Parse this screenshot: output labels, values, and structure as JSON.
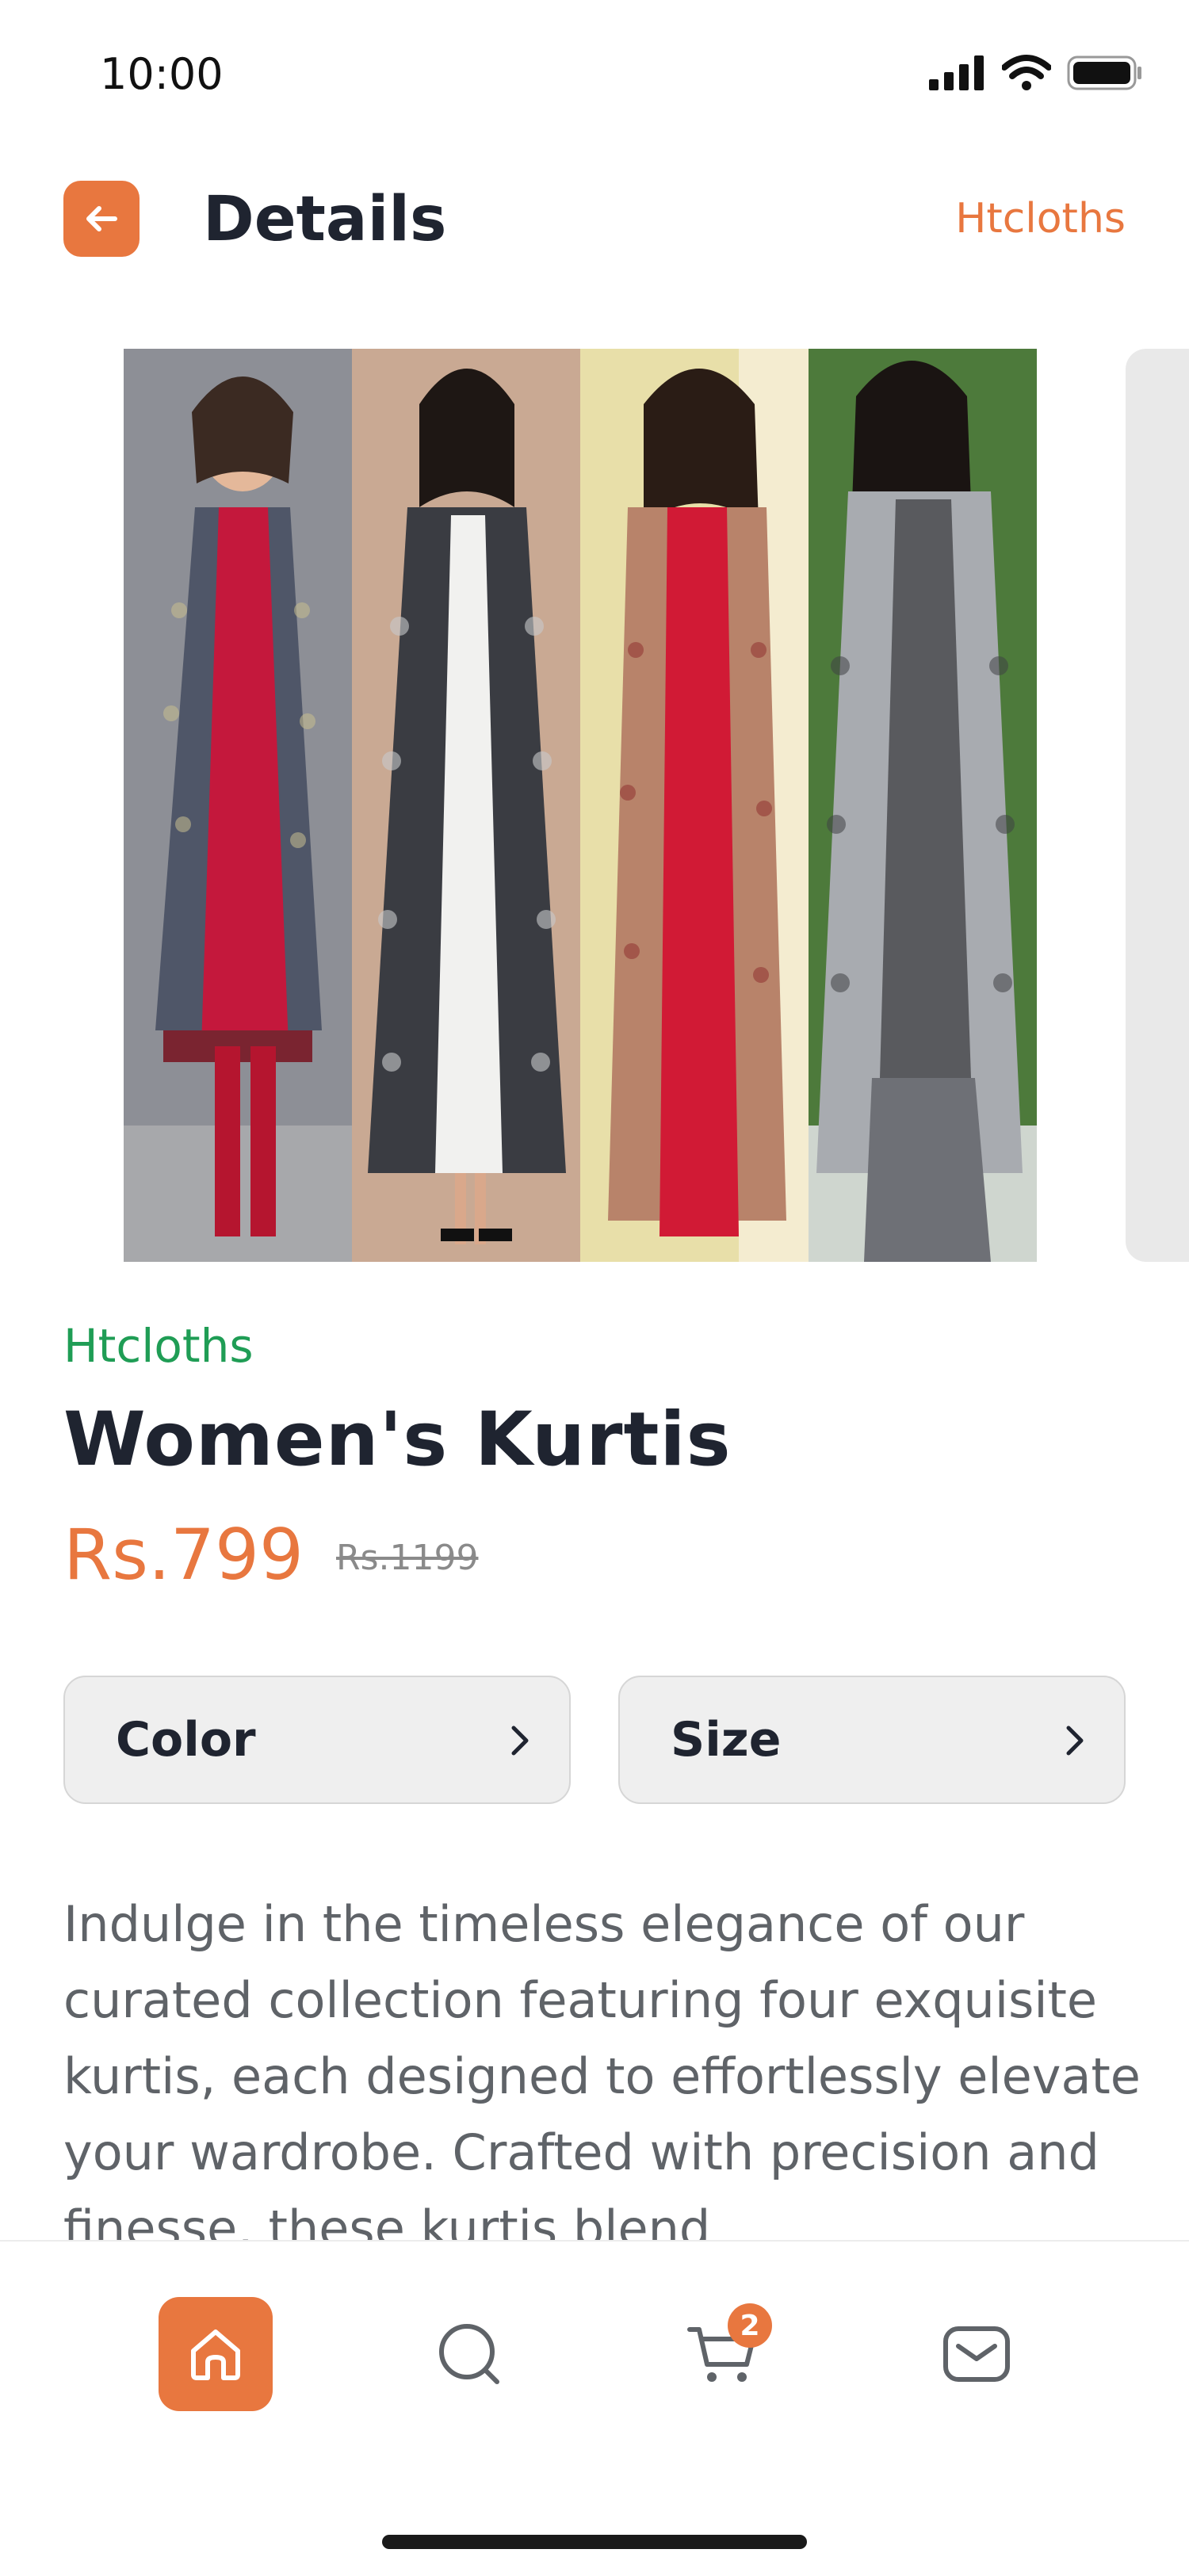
{
  "status_bar": {
    "time": "10:00"
  },
  "header": {
    "title": "Details",
    "brand": "Htcloths"
  },
  "product": {
    "brand": "Htcloths",
    "title": "Women's Kurtis",
    "price": "Rs.799",
    "old_price": "Rs.1199"
  },
  "options": [
    {
      "label": "Color"
    },
    {
      "label": "Size"
    }
  ],
  "description": "Indulge in the timeless elegance of our curated collection featuring four exquisite kurtis, each designed to effortlessly elevate your wardrobe. Crafted with precision and finesse, these kurtis blend",
  "nav": {
    "cart_badge": "2",
    "icons": [
      "home-icon",
      "search-icon",
      "cart-icon",
      "mail-icon"
    ]
  },
  "colors": {
    "accent": "#e8773f",
    "brand_green": "#1f9d55",
    "title_dark": "#1f2430",
    "body_gray": "#5f6368"
  }
}
